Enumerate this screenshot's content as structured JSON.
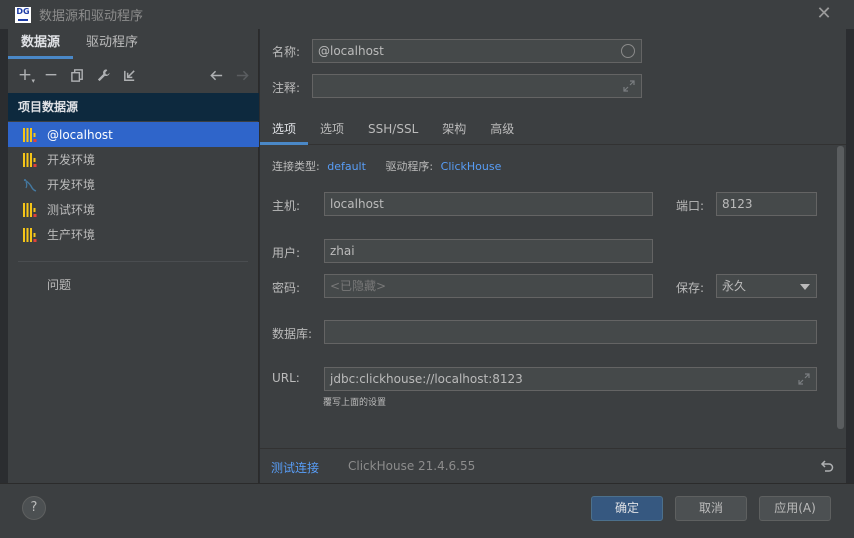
{
  "window": {
    "title": "数据源和驱动程序",
    "logo": "DG"
  },
  "left_tabs": [
    {
      "label": "数据源",
      "active": true
    },
    {
      "label": "驱动程序",
      "active": false
    }
  ],
  "toolbar_icons": [
    "add-icon",
    "remove-icon",
    "duplicate-icon",
    "wrench-icon",
    "import-icon",
    "back-arrow-icon",
    "forward-arrow-icon"
  ],
  "toolbar_glyphs": {
    "add": "+",
    "remove": "−"
  },
  "section": {
    "header": "项目数据源"
  },
  "data_sources": [
    {
      "label": "@localhost",
      "icon": "clickhouse-icon",
      "selected": true
    },
    {
      "label": "开发环境",
      "icon": "clickhouse-icon",
      "selected": false
    },
    {
      "label": "开发环境",
      "icon": "mysql-icon",
      "selected": false
    },
    {
      "label": "测试环境",
      "icon": "clickhouse-icon",
      "selected": false
    },
    {
      "label": "生产环境",
      "icon": "clickhouse-icon",
      "selected": false
    }
  ],
  "problems_label": "问题",
  "form": {
    "name_label": "名称:",
    "name_value": "@localhost",
    "comment_label": "注释:",
    "comment_value": ""
  },
  "conn_tabs": [
    {
      "label": "选项",
      "active": true
    },
    {
      "label": "选项",
      "active": false
    },
    {
      "label": "SSH/SSL",
      "active": false
    },
    {
      "label": "架构",
      "active": false
    },
    {
      "label": "高级",
      "active": false
    }
  ],
  "general": {
    "conn_type_label": "连接类型:",
    "conn_type_value": "default",
    "driver_label": "驱动程序:",
    "driver_value": "ClickHouse",
    "host_label": "主机:",
    "host_value": "localhost",
    "port_label": "端口:",
    "port_value": "8123",
    "user_label": "用户:",
    "user_value": "zhai",
    "password_label": "密码:",
    "password_placeholder": "<已隐藏>",
    "save_label": "保存:",
    "save_value": "永久",
    "database_label": "数据库:",
    "database_value": "",
    "url_label": "URL:",
    "url_value": "jdbc:clickhouse://localhost:8123",
    "url_hint": "覆写上面的设置"
  },
  "bottom": {
    "test_connection": "测试连接",
    "driver_version": "ClickHouse 21.4.6.55"
  },
  "footer": {
    "help": "?",
    "ok": "确定",
    "cancel": "取消",
    "apply": "应用(A)"
  },
  "colors": {
    "accent": "#2f65ca",
    "link": "#589df6",
    "clickhouse_yellow": "#f5c518",
    "clickhouse_red": "#e0413a",
    "mysql_blue": "#4479a1"
  }
}
